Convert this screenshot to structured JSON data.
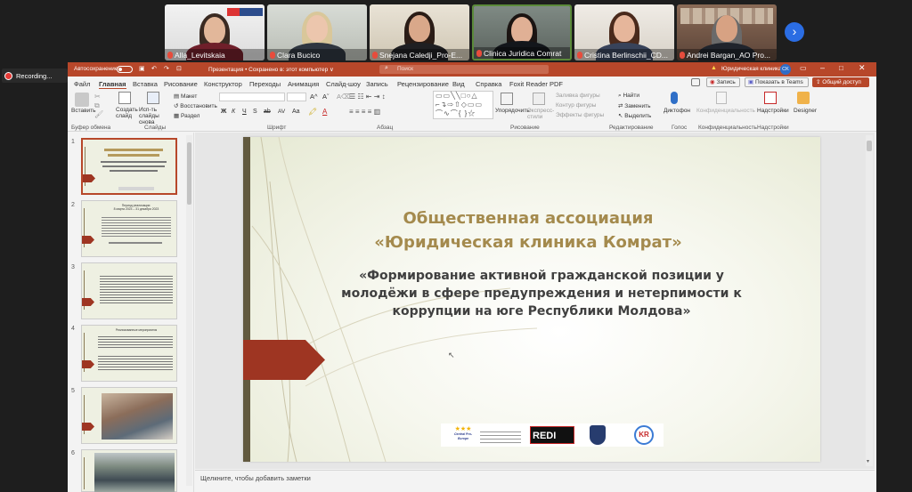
{
  "meeting": {
    "recording_label": "Recording...",
    "participants": [
      {
        "name": "Alla_Levitskaia"
      },
      {
        "name": "Clara Bucico"
      },
      {
        "name": "Snejana Caledji_Pro-E..."
      },
      {
        "name": "Clinica Juridica Comrat"
      },
      {
        "name": "Cristina Berlinschii_CD..."
      },
      {
        "name": "Andrei Bargan_AO Pro..."
      }
    ]
  },
  "titlebar": {
    "autosave": "Автосохранение",
    "autosave_state": "Откл",
    "doc_title": "Презентация • Сохранено в: этот компьютер ∨",
    "search_placeholder": "Поиск",
    "user": "Юридическая клиника",
    "initials": "CK"
  },
  "ribbon": {
    "tabs": [
      "Файл",
      "Главная",
      "Вставка",
      "Рисование",
      "Конструктор",
      "Переходы",
      "Анимация",
      "Слайд-шоу",
      "Запись",
      "Рецензирование",
      "Вид",
      "Справка",
      "Foxit Reader PDF"
    ],
    "actions": {
      "record": "Запись",
      "present": "Показать в Teams",
      "share": "Общий доступ"
    },
    "groups": [
      "Буфер обмена",
      "Слайды",
      "Шрифт",
      "Абзац",
      "Рисование",
      "Редактирование",
      "Голос",
      "Конфиденциальность",
      "Надстройки"
    ],
    "buttons": {
      "paste": "Вставить",
      "new_slide": "Создать слайд",
      "reuse_slides": "Исп-ть слайды снова",
      "layout": "Макет",
      "reset": "Восстановить",
      "section": "Раздел",
      "arrange": "Упорядочить",
      "quick_styles": "Экспресс-стили",
      "shape_fill": "Заливка фигуры",
      "shape_outline": "Контур фигуры",
      "shape_effects": "Эффекты фигуры",
      "find": "Найти",
      "replace": "Заменить",
      "select": "Выделить",
      "dictate": "Диктофон",
      "sensitivity": "Конфиденциальность",
      "addins": "Надстройки",
      "designer": "Designer"
    },
    "font_size": "",
    "format_letters": [
      "Ж",
      "К",
      "Ч",
      "S",
      "ab",
      "AV",
      "Aa"
    ]
  },
  "slides": {
    "numbers": [
      "1",
      "2",
      "3",
      "4",
      "5",
      "6"
    ],
    "thumb2_title": "Период реализации:",
    "thumb2_sub": "8 марта 2023 – 31 декабря 2023",
    "thumb4_title": "Реализованные мероприятия"
  },
  "main_slide": {
    "title_line1": "Общественная ассоциация",
    "title_line2": "«Юридическая клиника Комрат»",
    "sub_line1": "«Формирование активной гражданской позиции у",
    "sub_line2": "молодёжи в сфере предупреждения и нетерпимости к",
    "sub_line3": "коррупции на юге Республики Молдова»",
    "logo_redi": "REDI",
    "logo_cpe": "Central Pro-Europe",
    "logo_kr": "KR"
  },
  "notes": {
    "placeholder": "Щелкните, чтобы добавить заметки"
  },
  "colors": {
    "ribbon_red": "#b7472a",
    "title_color": "#a48a4d",
    "subtitle_color": "#404040",
    "arrow": "#9e3522",
    "slide_bg": "#eef0e2"
  }
}
